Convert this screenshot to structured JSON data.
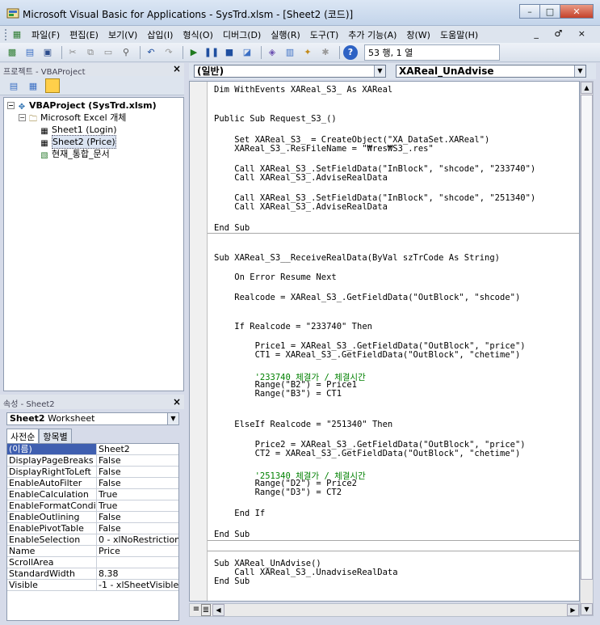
{
  "window": {
    "title": "Microsoft Visual Basic for Applications - SysTrd.xlsm - [Sheet2 (코드)]",
    "buttons": {
      "minimize": "–",
      "maximize": "□",
      "close": "✕"
    }
  },
  "menu": {
    "items": [
      "파일(F)",
      "편집(E)",
      "보기(V)",
      "삽입(I)",
      "형식(O)",
      "디버그(D)",
      "실행(R)",
      "도구(T)",
      "추가 기능(A)",
      "창(W)",
      "도움말(H)"
    ],
    "mdi_controls": "_ ♂ ×"
  },
  "toolbar": {
    "position": "53 행, 1 열"
  },
  "project_panel": {
    "title": "프로젝트 - VBAProject",
    "close": "×",
    "tree": [
      {
        "label": "VBAProject (SysTrd.xlsm)",
        "bold": true
      },
      {
        "label": "Microsoft Excel 개체"
      },
      {
        "label": "Sheet1 (Login)"
      },
      {
        "label": "Sheet2 (Price)"
      },
      {
        "label": "현재_통합_문서"
      }
    ]
  },
  "properties_panel": {
    "title": "속성 - Sheet2",
    "close": "×",
    "object_name": "Sheet2",
    "object_type": "Worksheet",
    "tabs": [
      "사전순",
      "항목별"
    ],
    "rows": [
      {
        "name": "(이름)",
        "value": "Sheet2"
      },
      {
        "name": "DisplayPageBreaks",
        "value": "False"
      },
      {
        "name": "DisplayRightToLeft",
        "value": "False"
      },
      {
        "name": "EnableAutoFilter",
        "value": "False"
      },
      {
        "name": "EnableCalculation",
        "value": "True"
      },
      {
        "name": "EnableFormatConditi",
        "value": "True"
      },
      {
        "name": "EnableOutlining",
        "value": "False"
      },
      {
        "name": "EnablePivotTable",
        "value": "False"
      },
      {
        "name": "EnableSelection",
        "value": "0 - xlNoRestriction"
      },
      {
        "name": "Name",
        "value": "Price"
      },
      {
        "name": "ScrollArea",
        "value": ""
      },
      {
        "name": "StandardWidth",
        "value": "8.38"
      },
      {
        "name": "Visible",
        "value": "-1 - xlSheetVisible"
      }
    ]
  },
  "code_window": {
    "object_combo": "(일반)",
    "procedure_combo": "XAReal_UnAdvise",
    "lines": [
      "Dim WithEvents XAReal_S3_ As XAReal",
      "Public Sub Request_S3_()",
      "    Set XAReal_S3_ = CreateObject(\"XA_DataSet.XAReal\")",
      "    XAReal_S3_.ResFileName = \"₩res₩S3_.res\"",
      "    Call XAReal_S3_.SetFieldData(\"InBlock\", \"shcode\", \"233740\")",
      "    Call XAReal_S3_.AdviseRealData",
      "    Call XAReal_S3_.SetFieldData(\"InBlock\", \"shcode\", \"251340\")",
      "    Call XAReal_S3_.AdviseRealData",
      "End Sub",
      "Sub XAReal_S3__ReceiveRealData(ByVal szTrCode As String)",
      "    On Error Resume Next",
      "    Realcode = XAReal_S3_.GetFieldData(\"OutBlock\", \"shcode\")",
      "    If Realcode = \"233740\" Then",
      "        Price1 = XAReal_S3_.GetFieldData(\"OutBlock\", \"price\")",
      "        CT1 = XAReal_S3_.GetFieldData(\"OutBlock\", \"chetime\")",
      "        '233740 체결가 / 체결시간",
      "        Range(\"B2\") = Price1",
      "        Range(\"B3\") = CT1",
      "    ElseIf Realcode = \"251340\" Then",
      "        Price2 = XAReal_S3_.GetFieldData(\"OutBlock\", \"price\")",
      "        CT2 = XAReal_S3_.GetFieldData(\"OutBlock\", \"chetime\")",
      "        '251340 체결가 / 체결시간",
      "        Range(\"D2\") = Price2",
      "        Range(\"D3\") = CT2",
      "    End If",
      "End Sub",
      "Sub XAReal_UnAdvise()",
      "    Call XAReal_S3_.UnadviseRealData",
      "End Sub"
    ]
  }
}
